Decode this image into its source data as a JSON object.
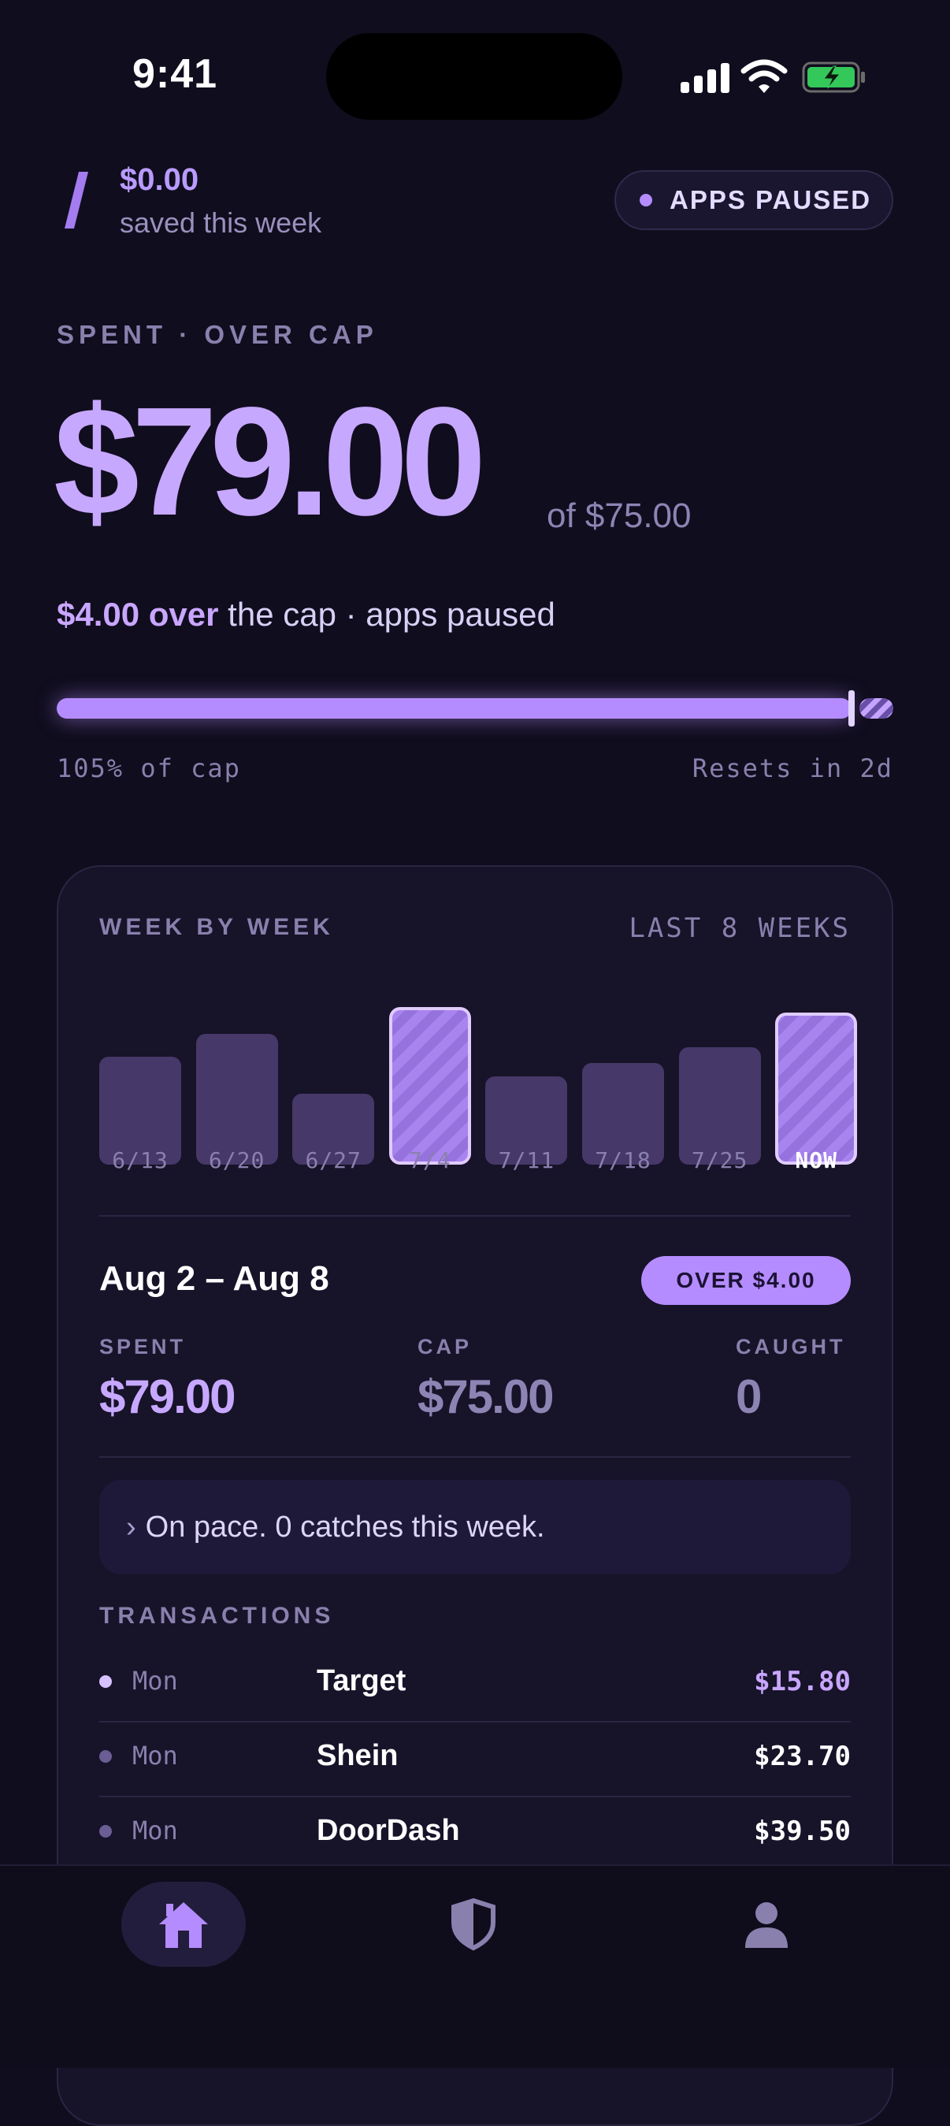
{
  "status_bar": {
    "time": "9:41"
  },
  "header": {
    "saved_amount": "$0.00",
    "saved_label": "saved this week",
    "status_pill": "APPS PAUSED"
  },
  "hero": {
    "section_label": "SPENT · OVER CAP",
    "spent_amount": "$79.00",
    "cap_text": "of $75.00",
    "over_amount": "$4.00 over",
    "over_suffix": " the cap · apps paused",
    "percent_of_cap": 1.05,
    "percent_label": "105% of cap",
    "reset_label": "Resets in 2d"
  },
  "weekly": {
    "title": "WEEK BY WEEK",
    "range_label": "LAST 8 WEEKS",
    "chart_data": {
      "type": "bar",
      "categories": [
        "6/13",
        "6/20",
        "6/27",
        "7/4",
        "7/11",
        "7/18",
        "7/25",
        "NOW"
      ],
      "values": [
        56,
        68,
        37,
        82,
        46,
        53,
        61,
        79
      ],
      "over_cap": [
        false,
        false,
        false,
        true,
        false,
        false,
        false,
        true
      ],
      "ylim": [
        0,
        82
      ]
    }
  },
  "week_detail": {
    "range_title": "Aug 2 – Aug 8",
    "over_badge": "OVER $4.00",
    "stats": [
      {
        "label": "SPENT",
        "value": "$79.00"
      },
      {
        "label": "CAP",
        "value": "$75.00"
      },
      {
        "label": "CAUGHT",
        "value": "0"
      }
    ],
    "pace_chevron": "›",
    "pace_message": "On pace. 0 catches this week."
  },
  "transactions": {
    "title": "TRANSACTIONS",
    "items": [
      {
        "day": "Mon",
        "merchant": "Target",
        "amount": "$15.80"
      },
      {
        "day": "Mon",
        "merchant": "Shein",
        "amount": "$23.70"
      },
      {
        "day": "Mon",
        "merchant": "DoorDash",
        "amount": "$39.50"
      }
    ]
  },
  "nav": {
    "items": [
      {
        "icon": "home-icon",
        "active": true
      },
      {
        "icon": "shield-icon",
        "active": false
      },
      {
        "icon": "user-icon",
        "active": false
      }
    ]
  },
  "colors": {
    "background": "#100d1e",
    "accent": "#b58cff",
    "accent_text": "#c7a8ff",
    "muted": "#8a80ad",
    "bar_default": "#463868"
  }
}
